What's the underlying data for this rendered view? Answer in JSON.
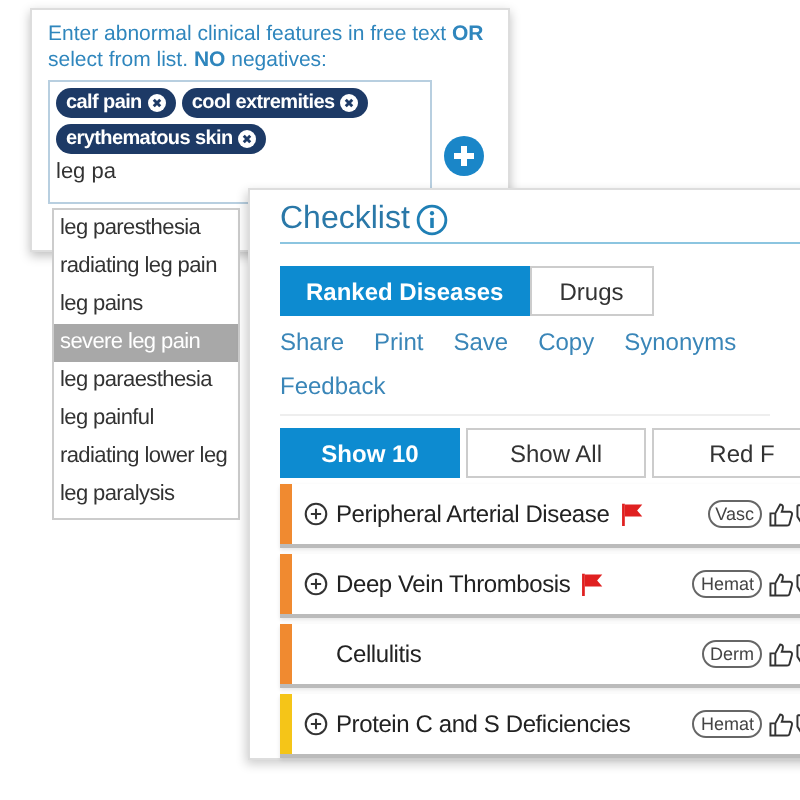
{
  "symptom_panel": {
    "instructions": "Enter abnormal clinical features in free text **OR** select from list. **NO** negatives:",
    "tags": [
      {
        "label": "calf pain"
      },
      {
        "label": "cool extremities"
      },
      {
        "label": "erythematous skin"
      }
    ],
    "input": {
      "value": "leg pa"
    },
    "suggestions": [
      {
        "label": "leg paresthesia",
        "selected": false
      },
      {
        "label": "radiating leg pain",
        "selected": false
      },
      {
        "label": "leg pains",
        "selected": false
      },
      {
        "label": "severe leg pain",
        "selected": true
      },
      {
        "label": "leg paraesthesia",
        "selected": false
      },
      {
        "label": "leg painful",
        "selected": false
      },
      {
        "label": "radiating lower leg",
        "selected": false
      },
      {
        "label": "leg paralysis",
        "selected": false
      }
    ]
  },
  "checklist": {
    "title": "Checklist",
    "tabs": [
      {
        "label": "Ranked Diseases",
        "selected": true
      },
      {
        "label": "Drugs",
        "selected": false
      }
    ],
    "actions": [
      "Share",
      "Print",
      "Save",
      "Copy",
      "Synonyms",
      "Feedback"
    ],
    "filters": [
      {
        "label": "Show 10",
        "selected": true
      },
      {
        "label": "Show All",
        "selected": false
      },
      {
        "label": "Red F",
        "selected": false
      }
    ],
    "diseases": [
      {
        "name": "Peripheral Arterial Disease",
        "expandable": true,
        "flagged": true,
        "specialty": "Vasc",
        "color": "#f08a30"
      },
      {
        "name": "Deep Vein Thrombosis",
        "expandable": true,
        "flagged": true,
        "specialty": "Hemat",
        "color": "#f08a30"
      },
      {
        "name": "Cellulitis",
        "expandable": false,
        "flagged": false,
        "specialty": "Derm",
        "color": "#f08a30"
      },
      {
        "name": "Protein C and S Deficiencies",
        "expandable": true,
        "flagged": false,
        "specialty": "Hemat",
        "color": "#f5c518"
      }
    ]
  }
}
